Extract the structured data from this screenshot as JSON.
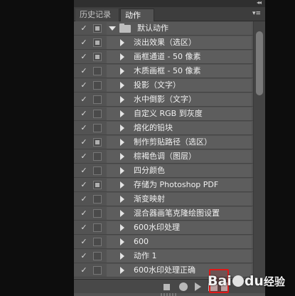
{
  "window": {
    "collapse_glyph": "◂◂",
    "close_glyph": "✕"
  },
  "tabs": [
    {
      "label": "历史记录",
      "active": false
    },
    {
      "label": "动作",
      "active": true
    }
  ],
  "panel_menu_glyph": "▾≡",
  "actions": [
    {
      "label": "默认动作",
      "checked": true,
      "dialog": true,
      "type": "set"
    },
    {
      "label": "淡出效果（选区）",
      "checked": true,
      "dialog": true,
      "type": "action"
    },
    {
      "label": "画框通道 - 50 像素",
      "checked": true,
      "dialog": true,
      "type": "action"
    },
    {
      "label": "木质画框 - 50 像素",
      "checked": true,
      "dialog": false,
      "type": "action"
    },
    {
      "label": "投影（文字）",
      "checked": true,
      "dialog": false,
      "type": "action"
    },
    {
      "label": "水中倒影（文字）",
      "checked": true,
      "dialog": false,
      "type": "action"
    },
    {
      "label": "自定义 RGB 到灰度",
      "checked": true,
      "dialog": false,
      "type": "action"
    },
    {
      "label": "熔化的铅块",
      "checked": true,
      "dialog": false,
      "type": "action"
    },
    {
      "label": "制作剪贴路径（选区）",
      "checked": true,
      "dialog": true,
      "type": "action"
    },
    {
      "label": "棕褐色调（图层）",
      "checked": true,
      "dialog": false,
      "type": "action"
    },
    {
      "label": "四分颜色",
      "checked": true,
      "dialog": false,
      "type": "action"
    },
    {
      "label": "存储为 Photoshop PDF",
      "checked": true,
      "dialog": true,
      "type": "action"
    },
    {
      "label": "渐变映射",
      "checked": true,
      "dialog": false,
      "type": "action"
    },
    {
      "label": "混合器画笔克隆绘图设置",
      "checked": true,
      "dialog": false,
      "type": "action"
    },
    {
      "label": "600水印处理",
      "checked": true,
      "dialog": false,
      "type": "action"
    },
    {
      "label": "600",
      "checked": true,
      "dialog": false,
      "type": "action"
    },
    {
      "label": "动作 1",
      "checked": true,
      "dialog": false,
      "type": "action"
    },
    {
      "label": "600水印处理正确",
      "checked": true,
      "dialog": false,
      "type": "action"
    }
  ],
  "bottom_toolbar": {
    "icons": [
      "stop-icon",
      "record-icon",
      "play-icon",
      "new-set-icon",
      "new-action-icon"
    ]
  },
  "colors": {
    "panel_bg": "#535353",
    "highlight": "#e01818"
  },
  "watermark": {
    "text_left": "Bai",
    "text_right": "du",
    "text_cn": "经验"
  }
}
